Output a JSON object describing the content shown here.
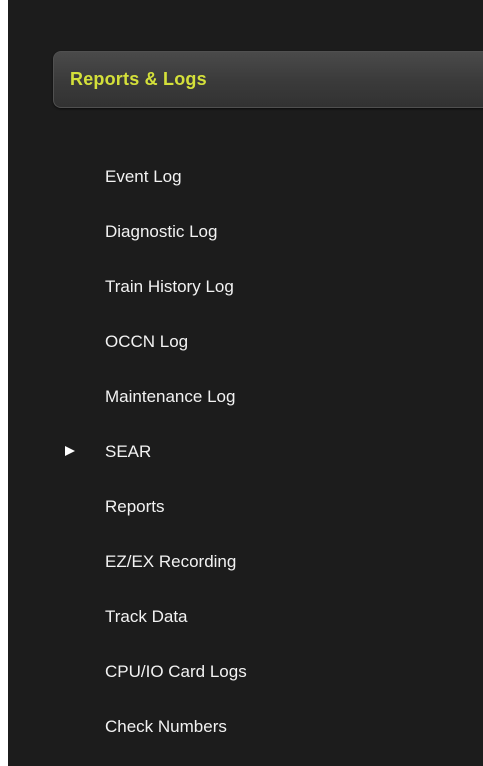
{
  "header": {
    "title": "Reports & Logs"
  },
  "menu": {
    "items": [
      {
        "label": "Event Log",
        "selected": false
      },
      {
        "label": "Diagnostic Log",
        "selected": false
      },
      {
        "label": "Train History Log",
        "selected": false
      },
      {
        "label": "OCCN Log",
        "selected": false
      },
      {
        "label": "Maintenance Log",
        "selected": false
      },
      {
        "label": "SEAR",
        "selected": true
      },
      {
        "label": "Reports",
        "selected": false
      },
      {
        "label": "EZ/EX Recording",
        "selected": false
      },
      {
        "label": "Track Data",
        "selected": false
      },
      {
        "label": "CPU/IO Card Logs",
        "selected": false
      },
      {
        "label": "Check Numbers",
        "selected": false
      }
    ],
    "selected_indicator_icon": "play-arrow-icon"
  },
  "colors": {
    "panel_background": "#1c1c1c",
    "header_text": "#d4e03a",
    "item_text": "#f2f2f2",
    "page_background": "#ffffff"
  }
}
